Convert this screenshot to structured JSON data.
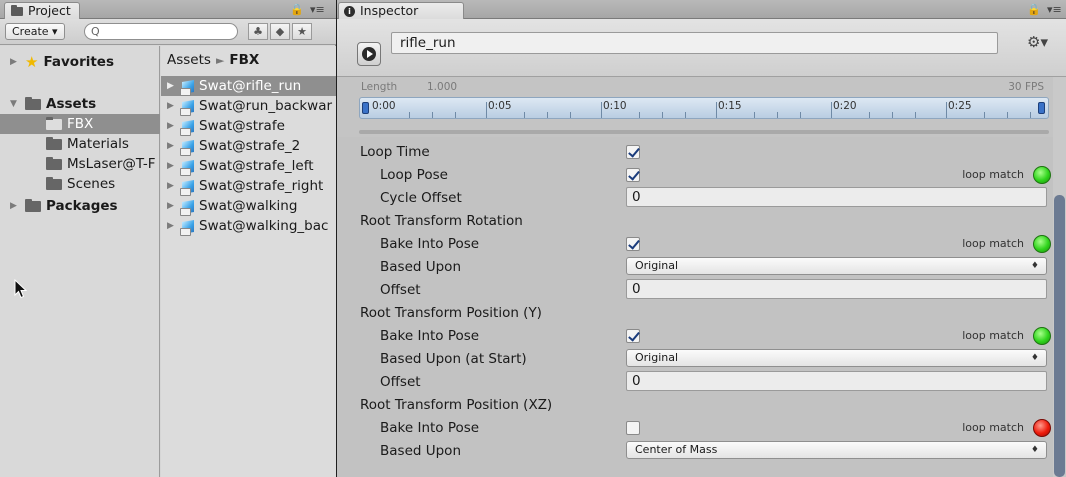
{
  "project": {
    "tab_label": "Project",
    "create_label": "Create ▾",
    "search_placeholder": "",
    "tree": [
      {
        "label": "Favorites"
      },
      {
        "label": "Assets"
      },
      {
        "label": "FBX"
      },
      {
        "label": "Materials"
      },
      {
        "label": "MsLaser@T-F"
      },
      {
        "label": "Scenes"
      },
      {
        "label": "Packages"
      }
    ],
    "breadcrumb": {
      "root": "Assets",
      "sep": "►",
      "current": "FBX"
    },
    "assets": [
      "Swat@rifle_run",
      "Swat@run_backwar",
      "Swat@strafe",
      "Swat@strafe_2",
      "Swat@strafe_left",
      "Swat@strafe_right",
      "Swat@walking",
      "Swat@walking_bac"
    ]
  },
  "inspector": {
    "tab_label": "Inspector",
    "clip_name": "rifle_run",
    "length_label": "Length",
    "length_value": "1.000",
    "fps": "30 FPS",
    "timeline_ticks": [
      "0:00",
      "0:05",
      "0:10",
      "0:15",
      "0:20",
      "0:25"
    ],
    "loop_match": "loop match",
    "properties": {
      "loop_time": {
        "label": "Loop Time",
        "checked": true
      },
      "loop_pose": {
        "label": "Loop Pose",
        "checked": true,
        "status": "green"
      },
      "cycle_offset": {
        "label": "Cycle Offset",
        "value": "0"
      },
      "rot_header": "Root Transform Rotation",
      "rot_bake": {
        "label": "Bake Into Pose",
        "checked": true,
        "status": "green"
      },
      "rot_based": {
        "label": "Based Upon",
        "value": "Original"
      },
      "rot_offset": {
        "label": "Offset",
        "value": "0"
      },
      "posy_header": "Root Transform Position (Y)",
      "posy_bake": {
        "label": "Bake Into Pose",
        "checked": true,
        "status": "green"
      },
      "posy_based": {
        "label": "Based Upon (at Start)",
        "value": "Original"
      },
      "posy_offset": {
        "label": "Offset",
        "value": "0"
      },
      "posxz_header": "Root Transform Position (XZ)",
      "posxz_bake": {
        "label": "Bake Into Pose",
        "checked": false,
        "status": "red"
      },
      "posxz_based": {
        "label": "Based Upon",
        "value": "Center of Mass"
      }
    }
  }
}
